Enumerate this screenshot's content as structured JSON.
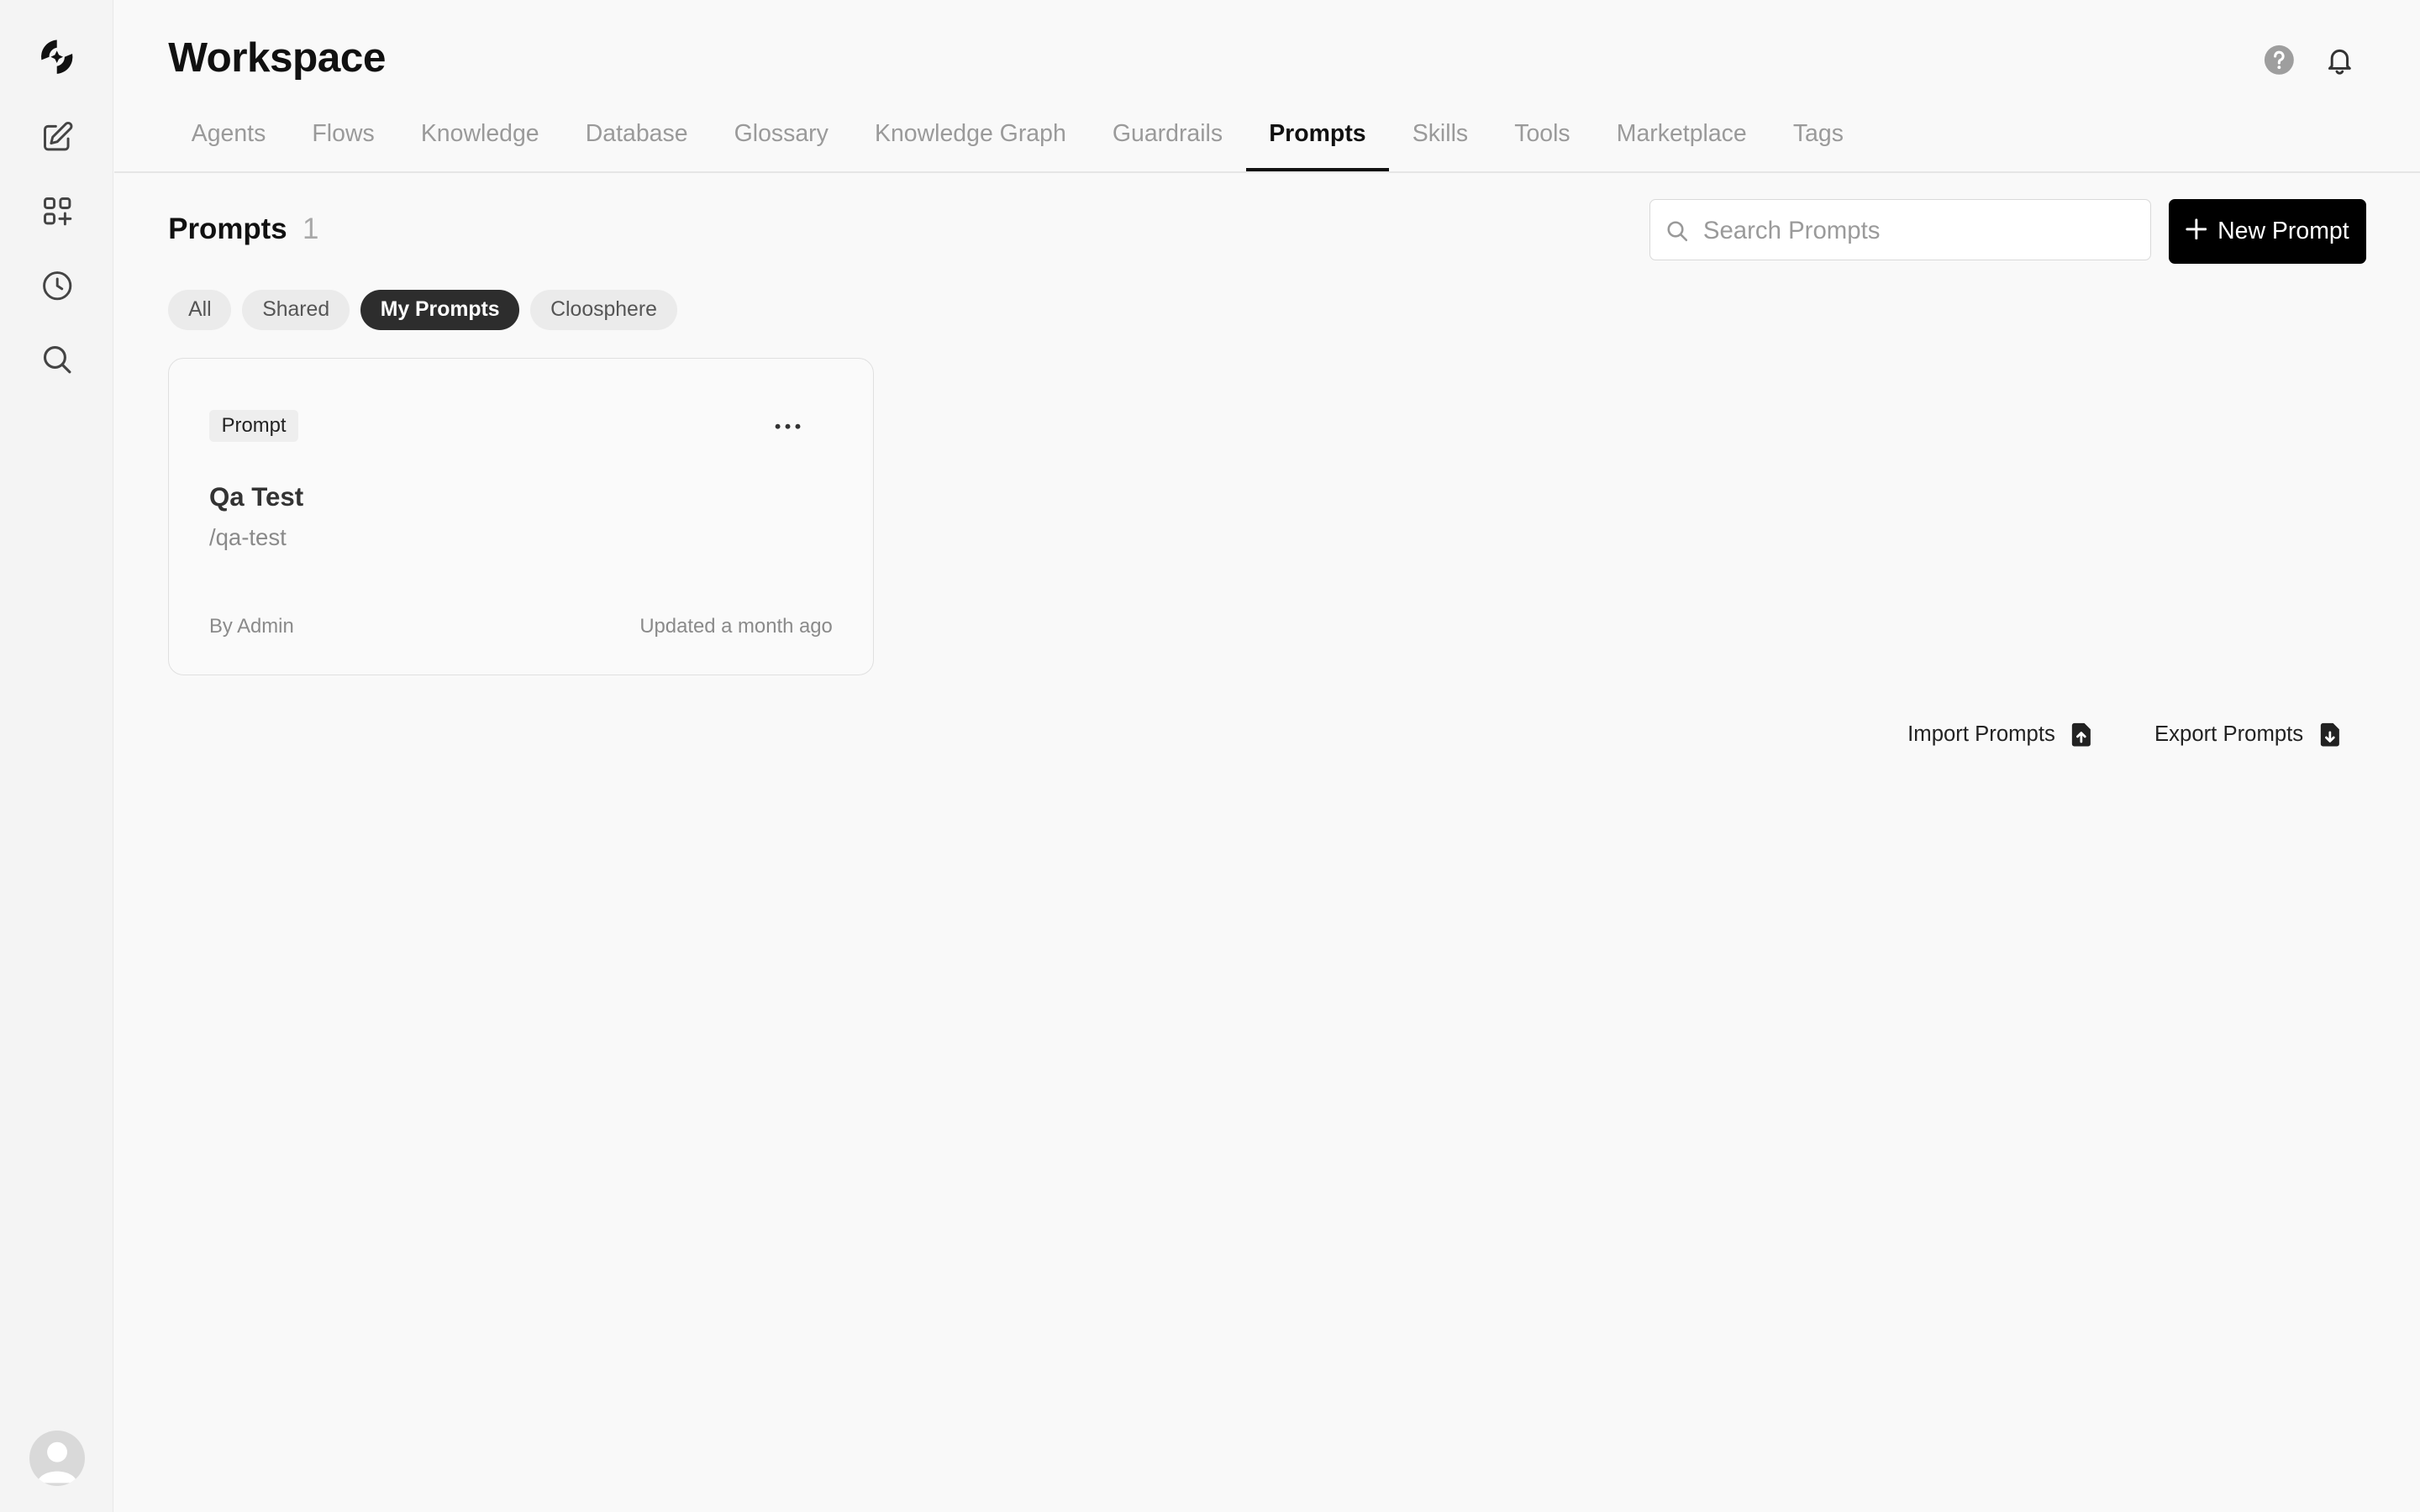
{
  "app": {
    "title": "Workspace",
    "colors": {
      "accent": "#000000",
      "background": "#f9f9f9",
      "muted_text": "#9a9a9a"
    }
  },
  "rail": {
    "items": [
      {
        "icon": "logo-icon"
      },
      {
        "icon": "edit-icon"
      },
      {
        "icon": "apps-icon"
      },
      {
        "icon": "history-icon"
      },
      {
        "icon": "search-icon"
      }
    ],
    "avatar_icon": "user-avatar-icon"
  },
  "header": {
    "icons": [
      "help-icon",
      "bell-icon"
    ]
  },
  "tabs": [
    {
      "label": "Agents",
      "active": false
    },
    {
      "label": "Flows",
      "active": false
    },
    {
      "label": "Knowledge",
      "active": false
    },
    {
      "label": "Database",
      "active": false
    },
    {
      "label": "Glossary",
      "active": false
    },
    {
      "label": "Knowledge Graph",
      "active": false
    },
    {
      "label": "Guardrails",
      "active": false
    },
    {
      "label": "Prompts",
      "active": true
    },
    {
      "label": "Skills",
      "active": false
    },
    {
      "label": "Tools",
      "active": false
    },
    {
      "label": "Marketplace",
      "active": false
    },
    {
      "label": "Tags",
      "active": false
    }
  ],
  "section": {
    "title": "Prompts",
    "count": "1",
    "search_placeholder": "Search Prompts",
    "search_value": "",
    "new_button_label": "New Prompt"
  },
  "filters": [
    {
      "label": "All",
      "active": false
    },
    {
      "label": "Shared",
      "active": false
    },
    {
      "label": "My Prompts",
      "active": true
    },
    {
      "label": "Cloosphere",
      "active": false
    }
  ],
  "prompts": [
    {
      "badge": "Prompt",
      "title": "Qa Test",
      "slug": "/qa-test",
      "author": "By Admin",
      "updated": "Updated a month ago"
    }
  ],
  "actions": {
    "import_label": "Import Prompts",
    "export_label": "Export Prompts"
  }
}
